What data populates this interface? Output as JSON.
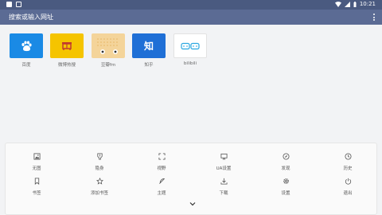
{
  "status": {
    "time": "10:21"
  },
  "appbar": {
    "search_placeholder": "搜索或输入网址"
  },
  "shortcuts": [
    {
      "label": "百度",
      "icon": "paw-icon",
      "color": "#1a8ae5"
    },
    {
      "label": "微博热搜",
      "icon": "weibo-hot-icon",
      "color": "#f5c400"
    },
    {
      "label": "豆瓣fm",
      "icon": "radio-icon",
      "color": "#f4d49a"
    },
    {
      "label": "知乎",
      "icon": "zhihu-icon",
      "color": "#1f6fd6"
    },
    {
      "label": "bilibili",
      "icon": "bilibili-logo",
      "color": "#ffffff"
    }
  ],
  "tools": [
    {
      "label": "无图",
      "icon": "image-icon"
    },
    {
      "label": "隐身",
      "icon": "incognito-icon"
    },
    {
      "label": "视野",
      "icon": "fullscreen-icon"
    },
    {
      "label": "UA设置",
      "icon": "monitor-icon"
    },
    {
      "label": "发现",
      "icon": "compass-icon"
    },
    {
      "label": "历史",
      "icon": "clock-icon"
    },
    {
      "label": "书签",
      "icon": "bookmark-icon"
    },
    {
      "label": "添加书签",
      "icon": "star-icon"
    },
    {
      "label": "主题",
      "icon": "feather-icon"
    },
    {
      "label": "下载",
      "icon": "download-icon"
    },
    {
      "label": "设置",
      "icon": "gear-icon"
    },
    {
      "label": "退出",
      "icon": "power-icon"
    }
  ],
  "colors": {
    "appbar": "#5b6b94",
    "statusbar": "#4a5a80",
    "accent": "#1a8ae5"
  }
}
